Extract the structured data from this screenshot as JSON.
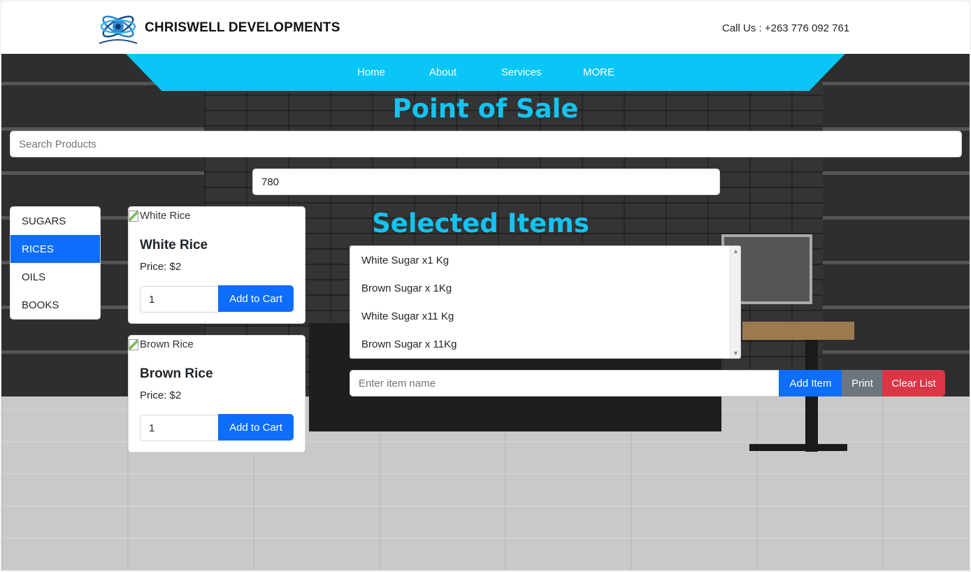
{
  "header": {
    "brand": "CHRISWELL DEVELOPMENTS",
    "call": "Call Us : +263 776 092 761",
    "logo_icon": "atom-logo-icon"
  },
  "nav": {
    "items": [
      "Home",
      "About",
      "Services",
      "MORE"
    ],
    "color": "#0ac6f6"
  },
  "page_title": "Point of Sale",
  "search": {
    "placeholder": "Search Products",
    "value": ""
  },
  "amount_field": {
    "value": "780"
  },
  "categories": {
    "items": [
      "SUGARS",
      "RICES",
      "OILS",
      "BOOKS"
    ],
    "active": "RICES"
  },
  "products": [
    {
      "image_alt": "White Rice",
      "name": "White Rice",
      "price": "Price: $2",
      "qty": "1",
      "button": "Add to Cart"
    },
    {
      "image_alt": "Brown Rice",
      "name": "Brown Rice",
      "price": "Price: $2",
      "qty": "1",
      "button": "Add to Cart"
    }
  ],
  "selected": {
    "title": "Selected Items",
    "items": [
      "White Sugar x1 Kg",
      "Brown Sugar x 1Kg",
      "White Sugar x11 Kg",
      "Brown Sugar x 11Kg"
    ]
  },
  "item_entry": {
    "placeholder": "Enter item name",
    "add_label": "Add Item",
    "print_label": "Print",
    "clear_label": "Clear List"
  },
  "colors": {
    "accent": "#14c3f0",
    "primary": "#0d6efd",
    "secondary": "#6c757d",
    "danger": "#dc3545"
  }
}
